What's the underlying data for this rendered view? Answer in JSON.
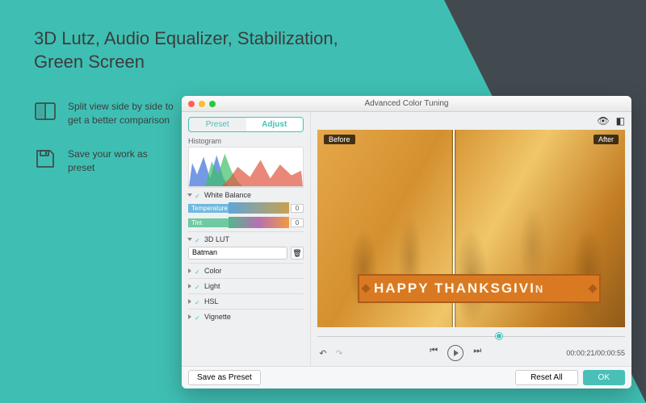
{
  "marketing": {
    "headline": "3D Lutz, Audio Equalizer, Stabilization, Green Screen",
    "features": [
      {
        "text": "Split view side by side to get a better comparison",
        "icon": "split-view-icon"
      },
      {
        "text": "Save your work as preset",
        "icon": "save-preset-icon"
      }
    ]
  },
  "window": {
    "title": "Advanced Color Tuning",
    "tabs": {
      "preset": "Preset",
      "adjust": "Adjust",
      "active": "adjust"
    },
    "histogram_label": "Histogram",
    "groups": {
      "white_balance": {
        "label": "White Balance",
        "expanded": true,
        "temperature": {
          "label": "Temperature",
          "value": "0"
        },
        "tint": {
          "label": "Tint",
          "value": "0"
        }
      },
      "lut": {
        "label": "3D LUT",
        "expanded": true,
        "selected": "Batman"
      },
      "color": {
        "label": "Color",
        "expanded": false
      },
      "light": {
        "label": "Light",
        "expanded": false
      },
      "hsl": {
        "label": "HSL",
        "expanded": false
      },
      "vignette": {
        "label": "Vignette",
        "expanded": false
      }
    },
    "preview": {
      "before_label": "Before",
      "after_label": "After",
      "banner_text": "HAPPY THANKSGIVI",
      "banner_trail": "N"
    },
    "playback": {
      "tc_current": "00:00:21",
      "tc_total": "00:00:55"
    },
    "footer": {
      "save_preset": "Save as Preset",
      "reset": "Reset All",
      "ok": "OK"
    }
  }
}
